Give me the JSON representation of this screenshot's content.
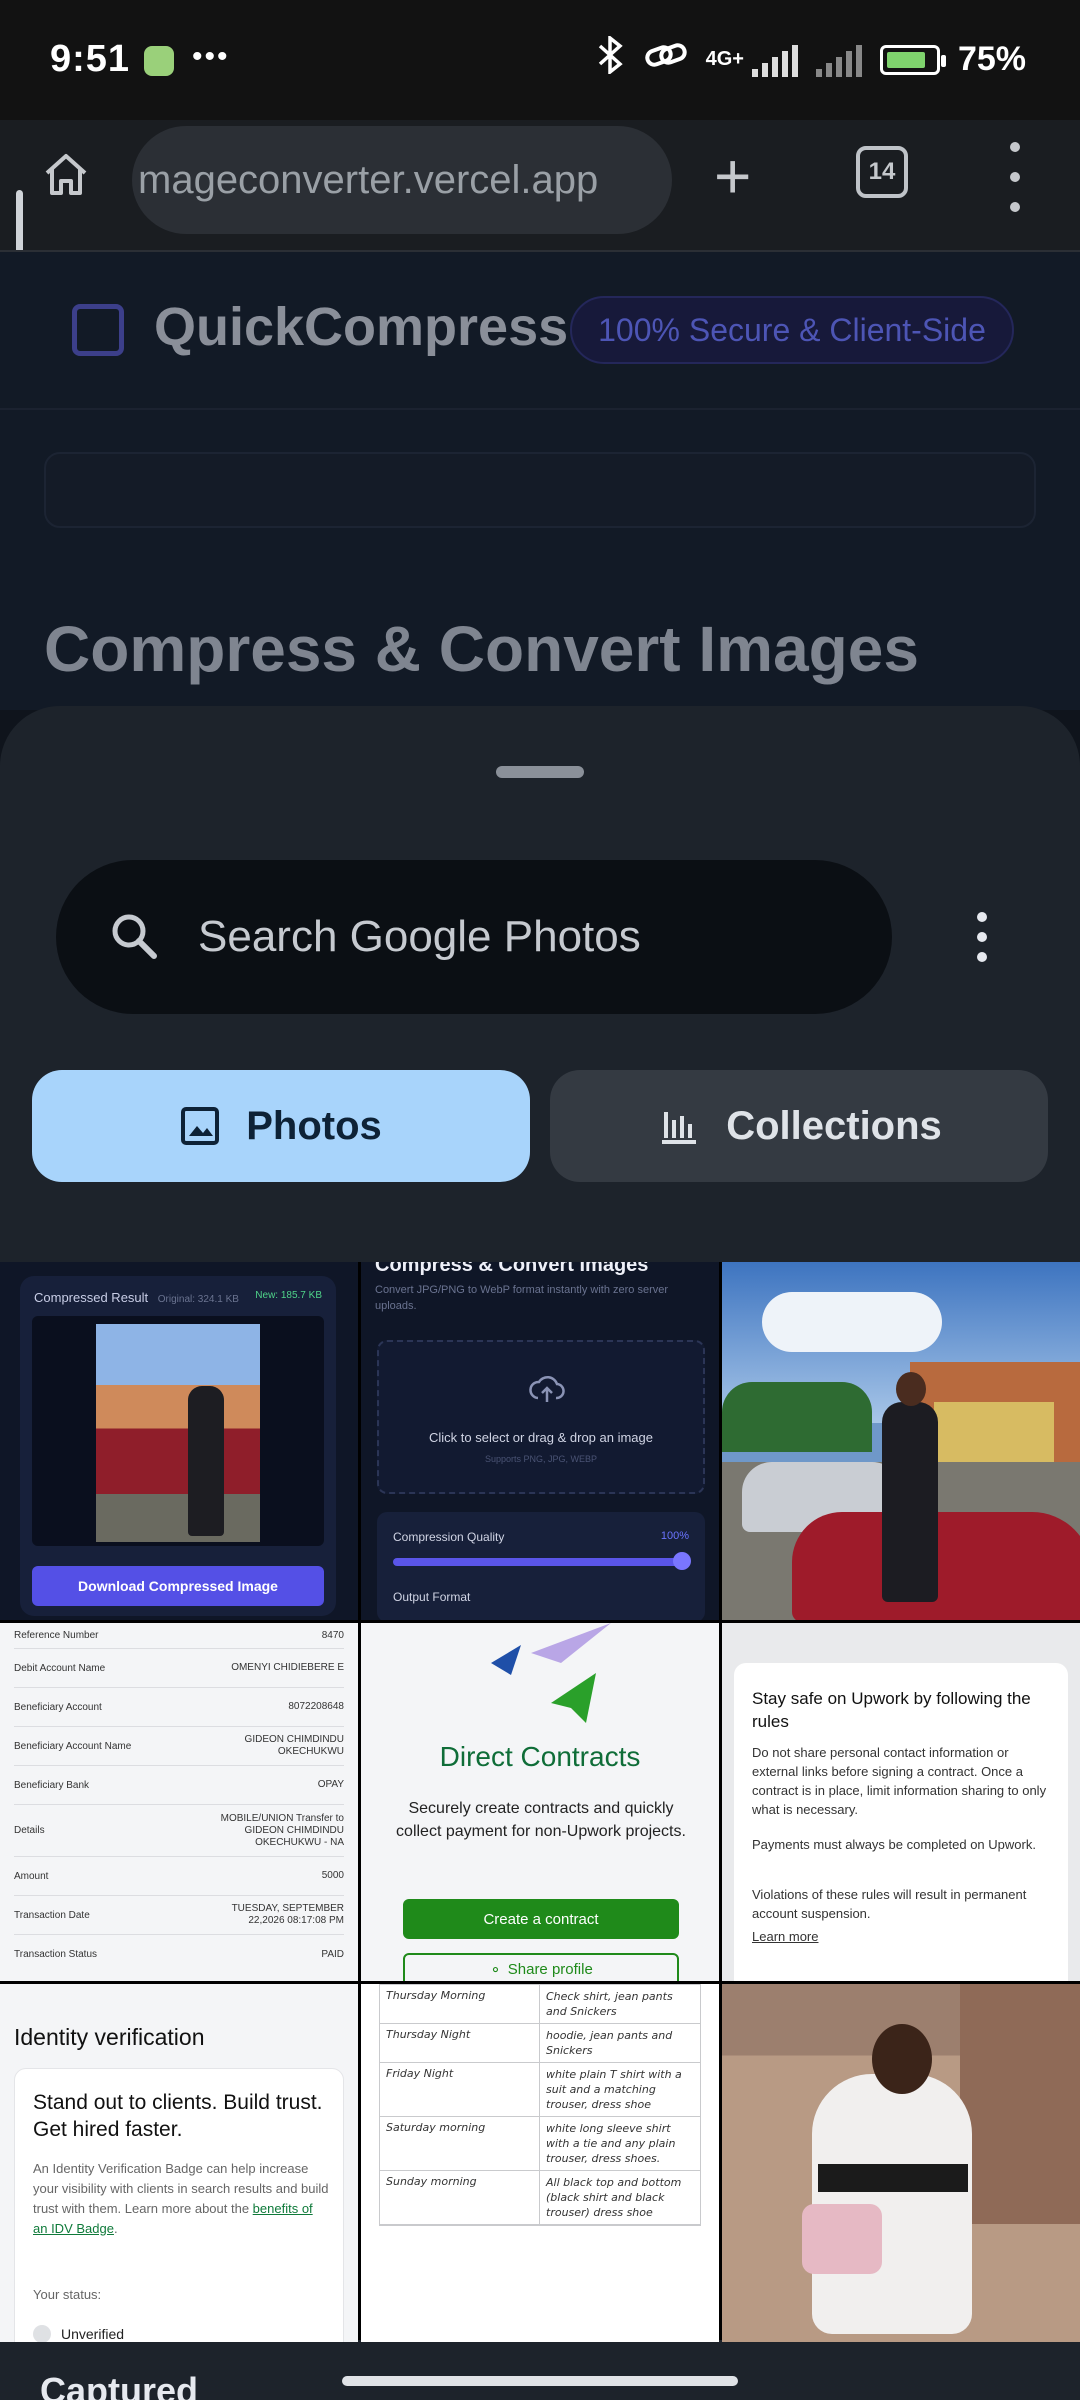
{
  "status_bar": {
    "time": "9:51",
    "more": "•••",
    "network": "4G+",
    "battery": "75%"
  },
  "browser": {
    "url": "mageconverter.vercel.app",
    "tab_count": "14"
  },
  "webpage": {
    "site_name": "QuickCompress",
    "badge": "100% Secure & Client-Side",
    "heading": "Compress & Convert Images"
  },
  "sheet": {
    "search_placeholder": "Search Google Photos",
    "tabs": [
      {
        "label": "Photos",
        "selected": true
      },
      {
        "label": "Collections",
        "selected": false
      }
    ]
  },
  "thumbnails": {
    "t1": {
      "title": "Compressed Result",
      "original": "Original: 324.1 KB",
      "new": "New: 185.7 KB",
      "button": "Download Compressed Image"
    },
    "t2": {
      "heading": "Compress & Convert Images",
      "subtitle": "Convert JPG/PNG to WebP format instantly with zero server uploads.",
      "drop_text": "Click to select or drag & drop an image",
      "drop_support": "Supports PNG, JPG, WEBP",
      "quality_label": "Compression Quality",
      "quality_value": "100%",
      "output_label": "Output Format"
    },
    "t4": {
      "rows": [
        {
          "label": "Reference Number",
          "value": "8470"
        },
        {
          "label": "Debit Account Name",
          "value": "OMENYI CHIDIEBERE E"
        },
        {
          "label": "Beneficiary Account",
          "value": "8072208648"
        },
        {
          "label": "Beneficiary Account Name",
          "value": "GIDEON CHIMDINDU OKECHUKWU"
        },
        {
          "label": "Beneficiary Bank",
          "value": "OPAY"
        },
        {
          "label": "Details",
          "value": "MOBILE/UNION Transfer to GIDEON CHIMDINDU OKECHUKWU - NA"
        },
        {
          "label": "Amount",
          "value": "5000"
        },
        {
          "label": "Transaction Date",
          "value": "TUESDAY, SEPTEMBER 22,2026 08:17:08 PM"
        },
        {
          "label": "Transaction Status",
          "value": "PAID"
        }
      ]
    },
    "t5": {
      "title": "Direct Contracts",
      "description": "Securely create contracts and quickly collect payment for non-Upwork projects.",
      "primary_button": "Create a contract",
      "secondary_button": "Share profile"
    },
    "t6": {
      "heading": "Stay safe on Upwork by following the rules",
      "p1": "Do not share personal contact information or external links before signing a contract. Once a contract is in place, limit information sharing to only what is necessary.",
      "p2": "Payments must always be completed on Upwork.",
      "p3": "Violations of these rules will result in permanent account suspension.",
      "link": "Learn more"
    },
    "t7": {
      "heading": "Identity verification",
      "subheading": "Stand out to clients. Build trust. Get hired faster.",
      "body_prefix": "An Identity Verification Badge can help increase your visibility with clients in search results and build trust with them. Learn more about the ",
      "body_link": "benefits of an IDV Badge",
      "status_label": "Your status:",
      "status_value": "Unverified"
    },
    "t8": {
      "rows": [
        {
          "day": "Thursday Morning",
          "outfit": "Check shirt, jean pants and Snickers"
        },
        {
          "day": "Thursday Night",
          "outfit": "hoodie, jean pants and Snickers"
        },
        {
          "day": "Friday Night",
          "outfit": "white plain T shirt with a suit and a matching trouser, dress shoe"
        },
        {
          "day": "Saturday morning",
          "outfit": "white long sleeve shirt with a tie and any plain trouser, dress shoes."
        },
        {
          "day": "Sunday morning",
          "outfit": "All black top and bottom (black shirt and black trouser) dress shoe"
        }
      ]
    }
  },
  "bottom_peek": "Captured"
}
